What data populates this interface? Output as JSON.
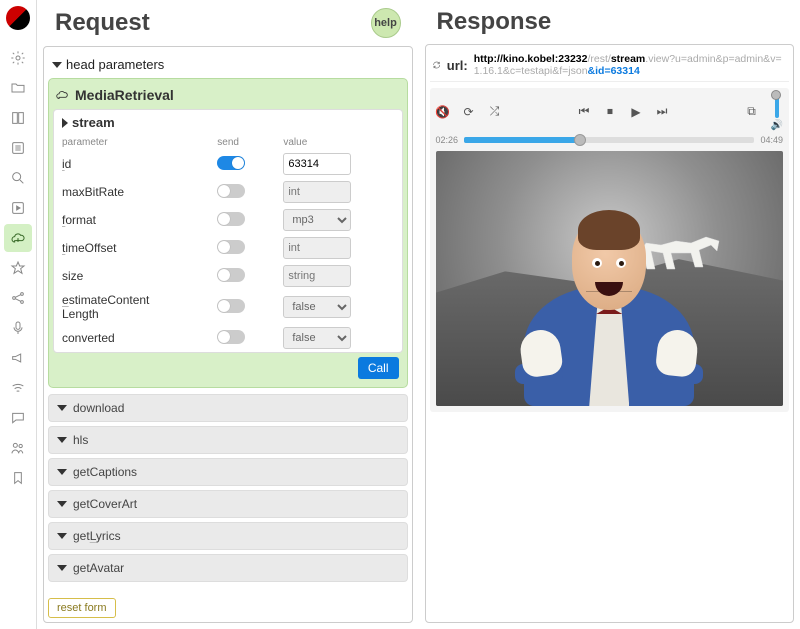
{
  "request": {
    "title": "Request",
    "help_label": "help",
    "head_params_label": "head parameters",
    "group_title": "MediaRetrieval",
    "method_name": "stream",
    "columns": {
      "parameter": "parameter",
      "send": "send",
      "value": "value"
    },
    "params": [
      {
        "name": "id",
        "underline": "i",
        "send": true,
        "type": "text",
        "value": "63314"
      },
      {
        "name": "maxBitRate",
        "underline": null,
        "send": false,
        "type": "number",
        "placeholder": "int"
      },
      {
        "name": "format",
        "underline": "f",
        "send": false,
        "type": "select",
        "value": "mp3"
      },
      {
        "name": "timeOffset",
        "underline": "t",
        "send": false,
        "type": "number",
        "placeholder": "int"
      },
      {
        "name": "size",
        "underline": null,
        "send": false,
        "type": "text",
        "placeholder": "string"
      },
      {
        "name": "estimateContentLength",
        "underline": "e",
        "send": false,
        "type": "select",
        "value": "false"
      },
      {
        "name": "converted",
        "underline": null,
        "send": false,
        "type": "select",
        "value": "false"
      }
    ],
    "call_label": "Call",
    "folded_methods": [
      "download",
      "hls",
      "getCaptions",
      "getCoverArt",
      "getLyrics",
      "getAvatar"
    ],
    "reset_label": "reset form"
  },
  "response": {
    "title": "Response",
    "url_label": "url:",
    "url_parts": {
      "pre": "http://kino.kobel:23232",
      "rest": "/rest/",
      "stream": "stream",
      "mid": ".view?u=admin&p=admin&v=1.16.1&c=testapi&f=json",
      "tail": "&id=63314"
    },
    "player": {
      "time_current": "02:26",
      "time_total": "04:49"
    }
  },
  "iconbar_icons": [
    "gear",
    "folder",
    "book",
    "list",
    "search",
    "play",
    "cloud",
    "star",
    "share",
    "mic",
    "bullhorn",
    "wifi",
    "chat",
    "users",
    "bookmark"
  ],
  "active_icon": "cloud"
}
